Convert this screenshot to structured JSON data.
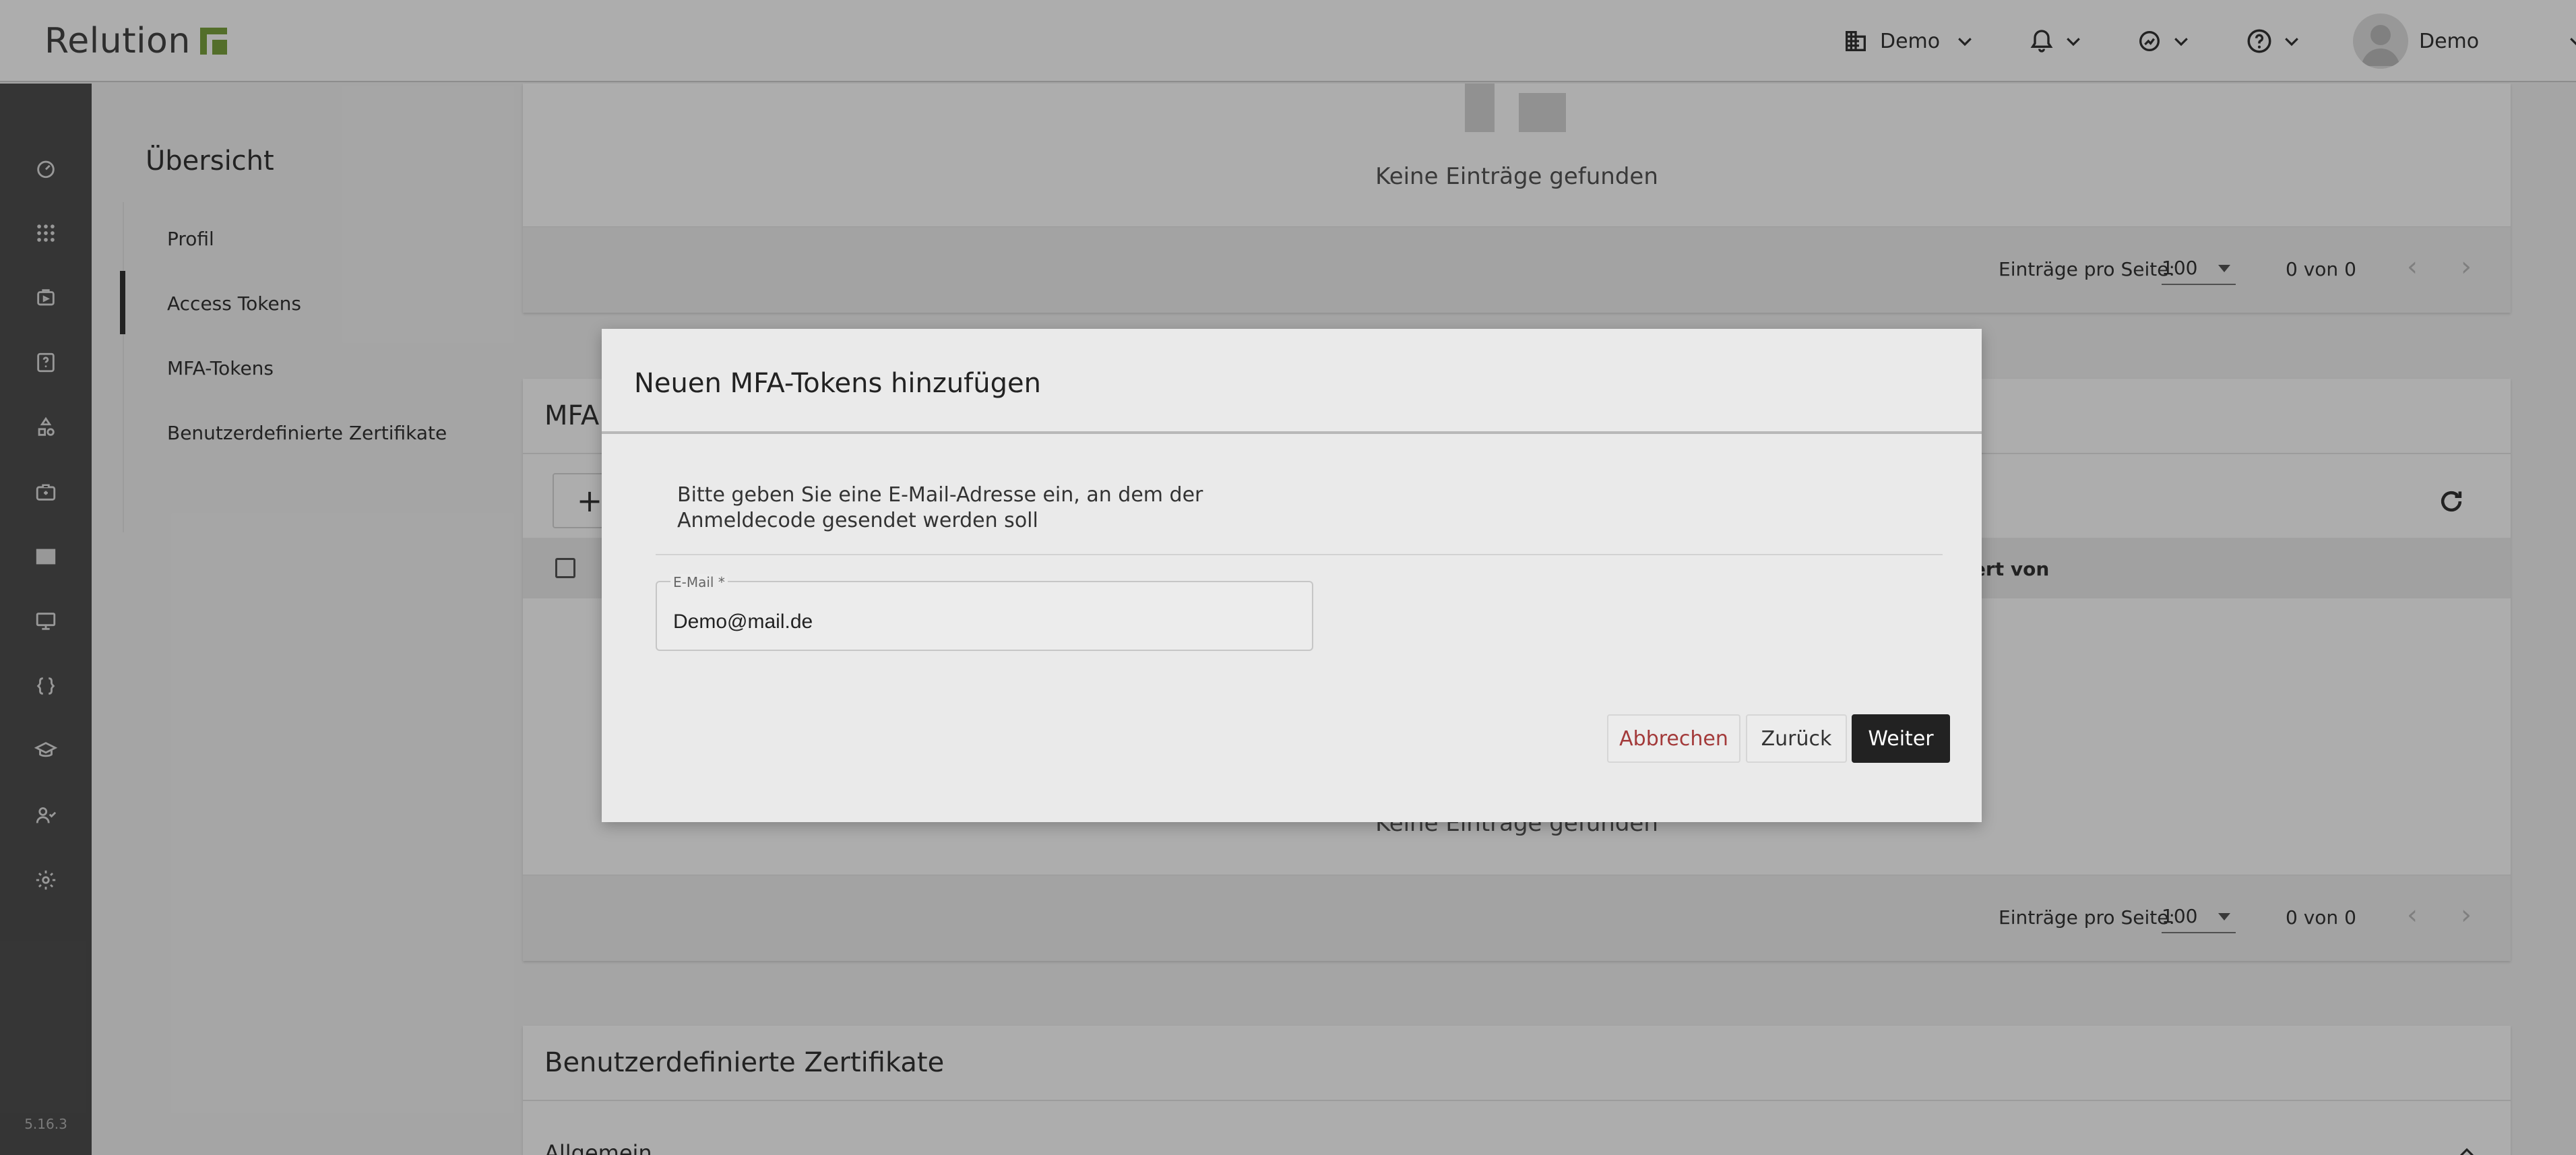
{
  "app": {
    "logo_text": "Relution",
    "brand_color": "#7ba23f"
  },
  "header": {
    "org_label": "Demo",
    "user_label": "Demo"
  },
  "sidebar": {
    "icons": [
      "dashboard-icon",
      "apps-grid-icon",
      "devices-icon",
      "policies-icon",
      "compliance-icon",
      "briefcase-icon",
      "book-icon",
      "screen-icon",
      "code-icon",
      "education-icon",
      "users-icon",
      "gear-icon"
    ],
    "version": "5.16.3"
  },
  "subnav": {
    "title": "Übersicht",
    "items": [
      {
        "label": "Profil"
      },
      {
        "label": "Access Tokens",
        "active": true
      },
      {
        "label": "MFA-Tokens"
      },
      {
        "label": "Benutzerdefinierte Zertifikate"
      }
    ]
  },
  "access_tokens": {
    "empty_text": "Keine Einträge gefunden",
    "pager": {
      "label": "Einträge pro Seite:",
      "per_page": "100",
      "count": "0 von 0"
    }
  },
  "mfa_tokens": {
    "title": "MFA",
    "column_visible": "ziert von",
    "empty_text": "Keine Einträge gefunden",
    "pager": {
      "label": "Einträge pro Seite:",
      "per_page": "100",
      "count": "0 von 0"
    }
  },
  "certificates": {
    "title": "Benutzerdefinierte Zertifikate",
    "section": "Allgemein"
  },
  "modal": {
    "title": "Neuen MFA-Tokens hinzufügen",
    "description": "Bitte geben Sie eine E-Mail-Adresse ein, an dem der Anmeldecode gesendet werden soll",
    "email_label": "E-Mail *",
    "email_value": "Demo@mail.de",
    "cancel_label": "Abbrechen",
    "back_label": "Zurück",
    "next_label": "Weiter"
  }
}
